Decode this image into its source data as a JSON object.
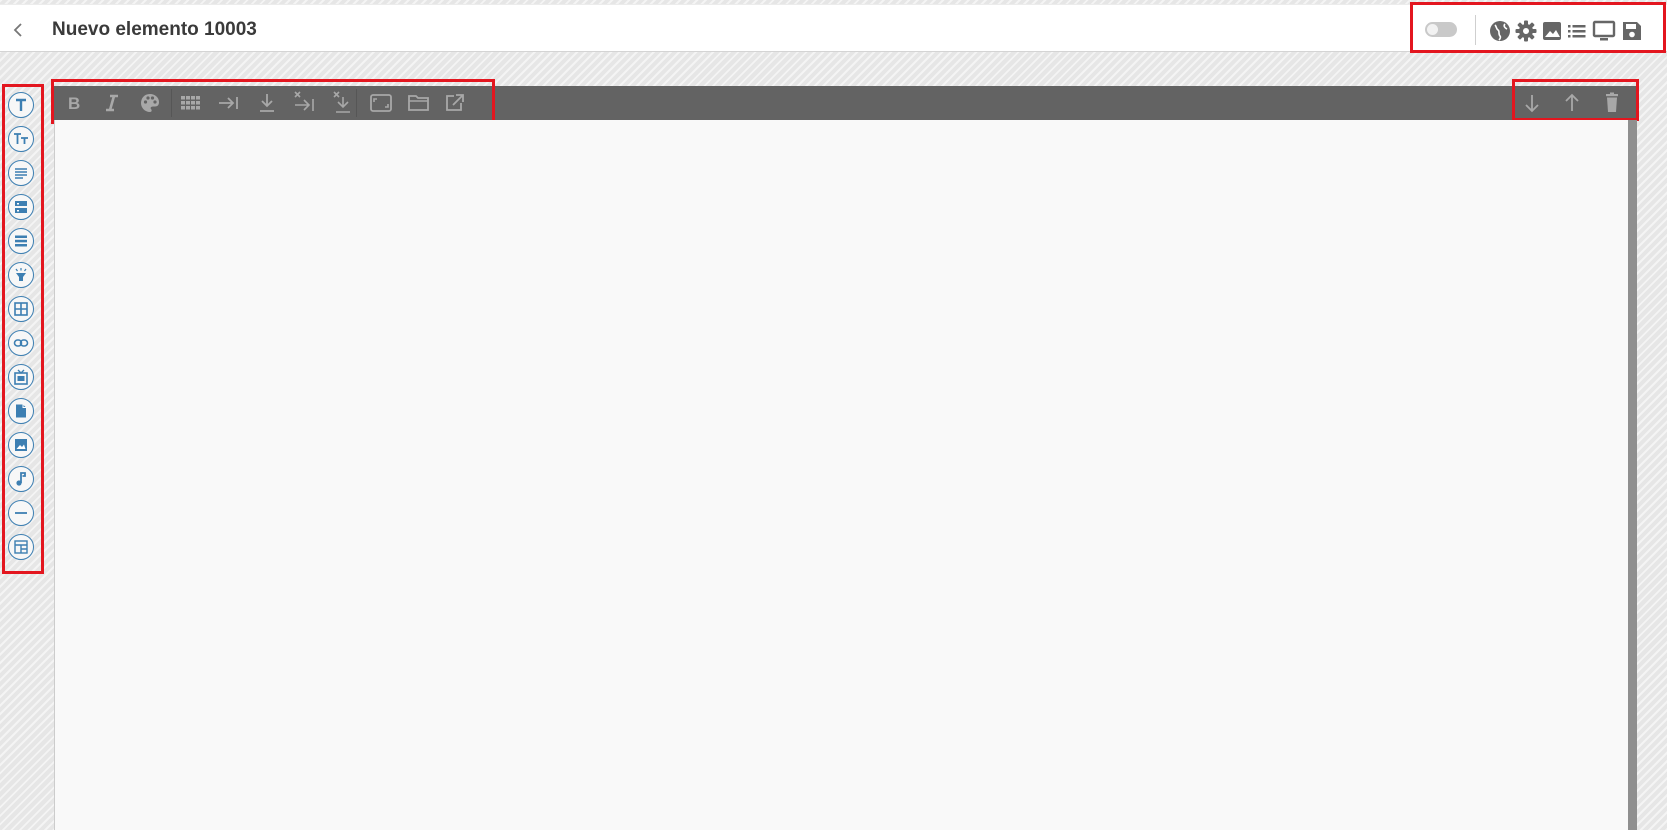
{
  "header": {
    "title": "Nuevo elemento 10003",
    "back_icon": "chevron-left-icon",
    "toggle_state": "off",
    "tools": [
      "globe-icon",
      "gear-icon",
      "image-icon",
      "list-icon",
      "monitor-icon",
      "save-icon"
    ]
  },
  "palette": {
    "items": [
      "text-icon",
      "text-size-icon",
      "paragraph-icon",
      "form-icon",
      "rows-icon",
      "highlight-icon",
      "table-icon",
      "link-icon",
      "embed-icon",
      "document-icon",
      "image-icon",
      "music-note-icon",
      "divider-icon",
      "layout-icon"
    ],
    "accent_color": "#3d7fb2"
  },
  "toolbar": {
    "left_tools": [
      "bold-icon",
      "italic-icon",
      "palette-icon",
      "grid-icon",
      "indent-icon",
      "move-down-icon",
      "remove-indent-icon",
      "remove-move-down-icon",
      "fit-icon",
      "folder-icon",
      "open-external-icon"
    ],
    "right_tools": [
      "arrow-down-icon",
      "arrow-up-icon",
      "trash-icon"
    ]
  },
  "colors": {
    "highlight": "#e3161f",
    "toolbar_bg": "#636363",
    "toolbar_icon": "#a8a8a8",
    "header_icon": "#666666"
  }
}
